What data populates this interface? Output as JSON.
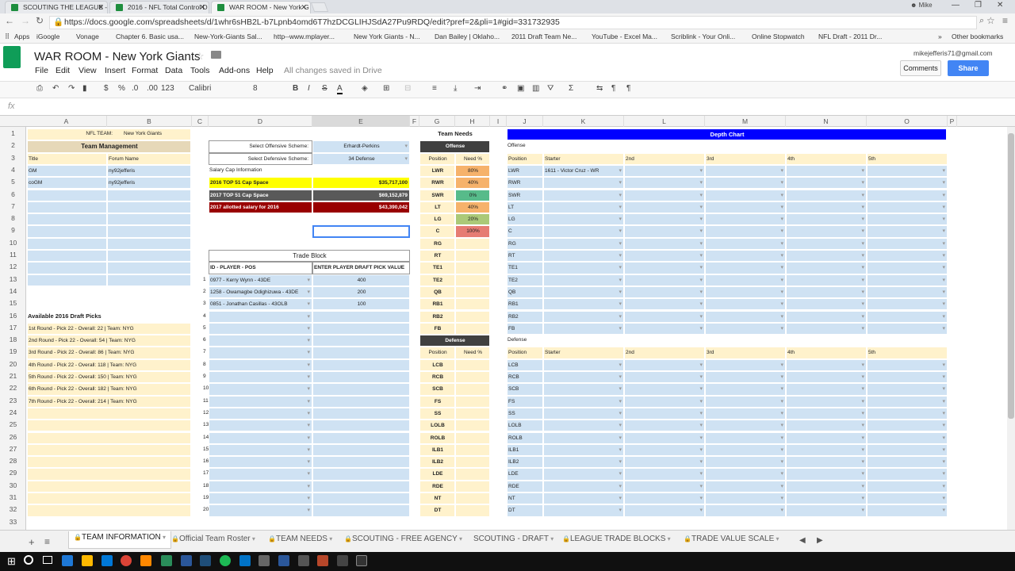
{
  "browser": {
    "tabs": [
      {
        "title": "SCOUTING THE LEAGUE -"
      },
      {
        "title": "2016 - NFL Total Control D"
      },
      {
        "title": "WAR ROOM - New York G"
      }
    ],
    "user": "Mike",
    "url": "https://docs.google.com/spreadsheets/d/1whr6sHB2L-b7Lpnb4omd6T7hzDCGLIHJSdA27Pu9RDQ/edit?pref=2&pli=1#gid=331732935",
    "bookmarks": [
      "Apps",
      "iGoogle",
      "Vonage",
      "Chapter 6. Basic usa...",
      "New-York-Giants Sal...",
      "http--www.mplayer...",
      "New York Giants - N...",
      "Dan Bailey | Oklaho...",
      "2011 Draft Team Ne...",
      "YouTube - Excel Ma...",
      "Scriblink - Your Onli...",
      "Online Stopwatch",
      "NFL Draft - 2011 Dr...",
      "Other bookmarks"
    ]
  },
  "doc": {
    "title": "WAR ROOM - New York Giants",
    "account": "mikejefferis71@gmail.com",
    "menu": [
      "File",
      "Edit",
      "View",
      "Insert",
      "Format",
      "Data",
      "Tools",
      "Add-ons",
      "Help"
    ],
    "save_status": "All changes saved in Drive",
    "comments": "Comments",
    "share": "Share"
  },
  "toolbar": {
    "font": "Calibri",
    "size": "8",
    "number": "123"
  },
  "columns": [
    "A",
    "B",
    "C",
    "D",
    "E",
    "F",
    "G",
    "H",
    "I",
    "J",
    "K",
    "L",
    "M",
    "N",
    "O",
    "P"
  ],
  "rows": [
    "1",
    "2",
    "3",
    "4",
    "5",
    "6",
    "7",
    "8",
    "9",
    "10",
    "11",
    "12",
    "13",
    "14",
    "15",
    "16",
    "17",
    "18",
    "19",
    "20",
    "21",
    "22",
    "23",
    "24",
    "25",
    "26",
    "27",
    "28",
    "29",
    "30",
    "31",
    "32",
    "33"
  ],
  "team": {
    "nfl_team_label": "NFL TEAM:",
    "nfl_team_value": "New York Giants",
    "mgmt_header": "Team Management",
    "col_title": "Title",
    "col_forum": "Forum Name",
    "gm": "GM",
    "gm_name": "ny92jefferis",
    "cogm": "coGM",
    "cogm_name": "ny92jefferis",
    "picks_header": "Available 2016 Draft Picks",
    "picks": [
      "1st Round - Pick 22 - Overall: 22 | Team: NYG",
      "2nd Round - Pick 22 - Overall: 54 | Team: NYG",
      "3rd Round - Pick 22 - Overall: 86 | Team: NYG",
      "4th Round - Pick 22 - Overall: 118 | Team: NYG",
      "5th Round - Pick 22 - Overall: 150 | Team: NYG",
      "6th Round - Pick 22 - Overall: 182 | Team: NYG",
      "7th Round - Pick 22 - Overall: 214 | Team: NYG"
    ]
  },
  "scheme": {
    "offense_label": "Select Offensive Scheme:",
    "offense_value": "Erhardt-Perkins",
    "defense_label": "Select Defensive Scheme:",
    "defense_value": "34 Defense"
  },
  "salary": {
    "header": "Salary Cap Information",
    "rows": [
      {
        "label": "2016 TOP 51 Cap Space",
        "value": "$35,717,100",
        "color": "#ffff00",
        "text": "#222222"
      },
      {
        "label": "2017 TOP 51 Cap Space",
        "value": "$69,152,879",
        "color": "#595959",
        "text": "#ffffff"
      },
      {
        "label": "2017 allotted salary for 2016",
        "value": "$43,390,042",
        "color": "#990000",
        "text": "#ffffff"
      }
    ]
  },
  "trade": {
    "header": "Trade Block",
    "col_player": "ID - PLAYER - POS",
    "col_value": "ENTER PLAYER DRAFT PICK VALUE",
    "numbers": [
      "1",
      "2",
      "3",
      "4",
      "5",
      "6",
      "7",
      "8",
      "9",
      "10",
      "11",
      "12",
      "13",
      "14",
      "15",
      "16",
      "17",
      "18",
      "19",
      "20"
    ],
    "players": [
      {
        "name": "0977 - Kerry Wynn - 43DE",
        "value": "400"
      },
      {
        "name": "1258 - Owamagbe Odighizuwa - 43DE",
        "value": "200"
      },
      {
        "name": "0851 - Jonathan Casillas - 43OLB",
        "value": "100"
      }
    ]
  },
  "needs": {
    "header": "Team Needs",
    "offense": "Offense",
    "defense": "Defense",
    "col_position": "Position",
    "col_need": "Need %",
    "off_positions": [
      {
        "pos": "LWR",
        "need": "80%",
        "color": "#f6b26b"
      },
      {
        "pos": "RWR",
        "need": "40%",
        "color": "#f6b26b"
      },
      {
        "pos": "SWR",
        "need": "0%",
        "color": "#57bb8a"
      },
      {
        "pos": "LT",
        "need": "40%",
        "color": "#f6b26b"
      },
      {
        "pos": "LG",
        "need": "20%",
        "color": "#abc978"
      },
      {
        "pos": "C",
        "need": "100%",
        "color": "#e67c73"
      },
      {
        "pos": "RG",
        "need": "",
        "color": "#fff2cc"
      },
      {
        "pos": "RT",
        "need": "",
        "color": "#fff2cc"
      },
      {
        "pos": "TE1",
        "need": "",
        "color": "#fff2cc"
      },
      {
        "pos": "TE2",
        "need": "",
        "color": "#fff2cc"
      },
      {
        "pos": "QB",
        "need": "",
        "color": "#fff2cc"
      },
      {
        "pos": "RB1",
        "need": "",
        "color": "#fff2cc"
      },
      {
        "pos": "RB2",
        "need": "",
        "color": "#fff2cc"
      },
      {
        "pos": "FB",
        "need": "",
        "color": "#fff2cc"
      }
    ],
    "def_positions": [
      "LCB",
      "RCB",
      "SCB",
      "FS",
      "SS",
      "LOLB",
      "ROLB",
      "ILB1",
      "ILB2",
      "LDE",
      "RDE",
      "NT",
      "DT"
    ]
  },
  "depth": {
    "header": "Depth Chart",
    "offense": "Offense",
    "defense": "Defense",
    "cols": [
      "Position",
      "Starter",
      "2nd",
      "3rd",
      "4th",
      "5th"
    ],
    "off_positions": [
      "LWR",
      "RWR",
      "SWR",
      "LT",
      "LG",
      "C",
      "RG",
      "RT",
      "TE1",
      "TE2",
      "QB",
      "RB1",
      "RB2",
      "FB"
    ],
    "def_positions": [
      "LCB",
      "RCB",
      "SCB",
      "FS",
      "SS",
      "LOLB",
      "ROLB",
      "ILB1",
      "ILB2",
      "LDE",
      "RDE",
      "NT",
      "DT"
    ],
    "lwr_starter": "1611 - Victor Cruz - WR"
  },
  "sheet_tabs": [
    "TEAM INFORMATION",
    "Official Team Roster",
    "TEAM NEEDS",
    "SCOUTING - FREE AGENCY",
    "SCOUTING - DRAFT",
    "LEAGUE TRADE BLOCKS",
    "TRADE VALUE SCALE"
  ],
  "sheet_tab_locked": [
    true,
    true,
    true,
    true,
    false,
    true,
    true
  ]
}
